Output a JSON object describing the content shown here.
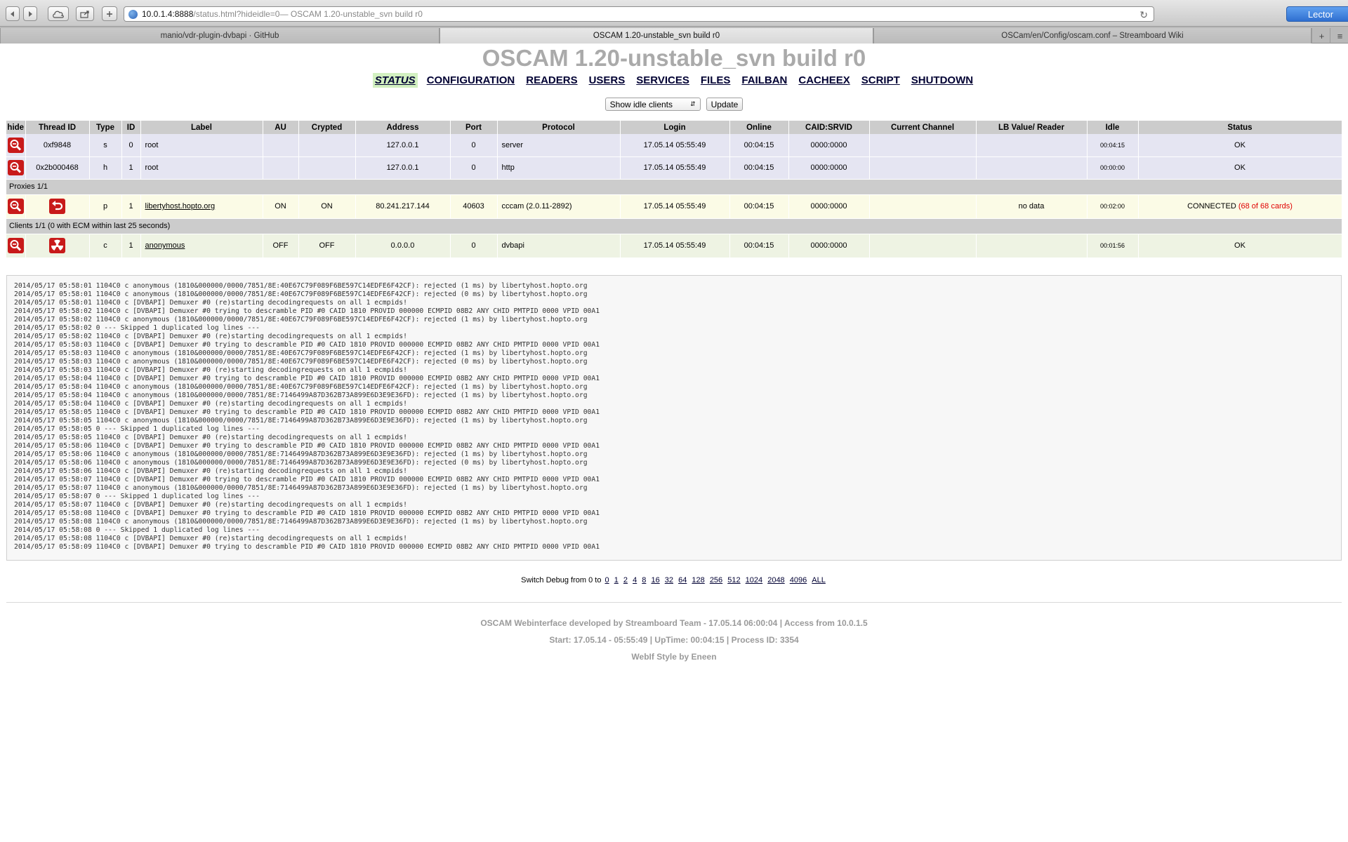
{
  "browser": {
    "url_host": "10.0.1.4:8888",
    "url_path": "/status.html?hideidle=0",
    "url_suffix": " — OSCAM 1.20-unstable_svn build r0",
    "reader_label": "Lector",
    "tabs": [
      {
        "label": "manio/vdr-plugin-dvbapi · GitHub"
      },
      {
        "label": "OSCAM 1.20-unstable_svn build r0"
      },
      {
        "label": "OSCam/en/Config/oscam.conf – Streamboard Wiki"
      }
    ]
  },
  "page": {
    "title": "OSCAM 1.20-unstable_svn build r0"
  },
  "nav": [
    "STATUS",
    "CONFIGURATION",
    "READERS",
    "USERS",
    "SERVICES",
    "FILES",
    "FAILBAN",
    "CACHEEX",
    "SCRIPT",
    "SHUTDOWN"
  ],
  "filter": {
    "select_value": "Show idle clients",
    "update_label": "Update"
  },
  "table": {
    "headers": [
      "hide",
      "Thread ID",
      "Type",
      "ID",
      "Label",
      "AU",
      "Crypted",
      "Address",
      "Port",
      "Protocol",
      "Login",
      "Online",
      "CAID:SRVID",
      "Current Channel",
      "LB Value/ Reader",
      "Idle",
      "Status"
    ],
    "server_rows": [
      {
        "thread": "0xf9848",
        "type": "s",
        "id": "0",
        "label": "root",
        "au": "",
        "crypted": "",
        "address": "127.0.0.1",
        "port": "0",
        "protocol": "server",
        "login": "17.05.14 05:55:49",
        "online": "00:04:15",
        "caid": "0000:0000",
        "channel": "",
        "lb": "",
        "idle": "00:04:15",
        "status": "OK"
      },
      {
        "thread": "0x2b000468",
        "type": "h",
        "id": "1",
        "label": "root",
        "au": "",
        "crypted": "",
        "address": "127.0.0.1",
        "port": "0",
        "protocol": "http",
        "login": "17.05.14 05:55:49",
        "online": "00:04:15",
        "caid": "0000:0000",
        "channel": "",
        "lb": "",
        "idle": "00:00:00",
        "status": "OK"
      }
    ],
    "proxies_caption": "Proxies 1/1",
    "proxy_row": {
      "type": "p",
      "id": "1",
      "label": "libertyhost.hopto.org",
      "au": "ON",
      "crypted": "ON",
      "address": "80.241.217.144",
      "port": "40603",
      "protocol": "cccam (2.0.11-2892)",
      "login": "17.05.14 05:55:49",
      "online": "00:04:15",
      "caid": "0000:0000",
      "channel": "",
      "lb": "no data",
      "idle": "00:02:00",
      "status": "CONNECTED",
      "cards": "(68 of 68 cards)"
    },
    "clients_caption": "Clients 1/1 (0 with ECM within last 25 seconds)",
    "client_row": {
      "type": "c",
      "id": "1",
      "label": "anonymous",
      "au": "OFF",
      "crypted": "OFF",
      "address": "0.0.0.0",
      "port": "0",
      "protocol": "dvbapi",
      "login": "17.05.14 05:55:49",
      "online": "00:04:15",
      "caid": "0000:0000",
      "channel": "",
      "lb": "",
      "idle": "00:01:56",
      "status": "OK"
    }
  },
  "log_lines": [
    "2014/05/17 05:58:01 1104C0 c anonymous (1810&000000/0000/7851/8E:40E67C79F089F6BE597C14EDFE6F42CF): rejected (1 ms) by libertyhost.hopto.org",
    "2014/05/17 05:58:01 1104C0 c anonymous (1810&000000/0000/7851/8E:40E67C79F089F6BE597C14EDFE6F42CF): rejected (0 ms) by libertyhost.hopto.org",
    "2014/05/17 05:58:01 1104C0 c [DVBAPI] Demuxer #0 (re)starting decodingrequests on all 1 ecmpids!",
    "2014/05/17 05:58:02 1104C0 c [DVBAPI] Demuxer #0 trying to descramble PID #0 CAID 1810 PROVID 000000 ECMPID 08B2 ANY CHID PMTPID 0000 VPID 00A1",
    "2014/05/17 05:58:02 1104C0 c anonymous (1810&000000/0000/7851/8E:40E67C79F089F6BE597C14EDFE6F42CF): rejected (1 ms) by libertyhost.hopto.org",
    "2014/05/17 05:58:02 0 --- Skipped 1 duplicated log lines ---",
    "2014/05/17 05:58:02 1104C0 c [DVBAPI] Demuxer #0 (re)starting decodingrequests on all 1 ecmpids!",
    "2014/05/17 05:58:03 1104C0 c [DVBAPI] Demuxer #0 trying to descramble PID #0 CAID 1810 PROVID 000000 ECMPID 08B2 ANY CHID PMTPID 0000 VPID 00A1",
    "2014/05/17 05:58:03 1104C0 c anonymous (1810&000000/0000/7851/8E:40E67C79F089F6BE597C14EDFE6F42CF): rejected (1 ms) by libertyhost.hopto.org",
    "2014/05/17 05:58:03 1104C0 c anonymous (1810&000000/0000/7851/8E:40E67C79F089F6BE597C14EDFE6F42CF): rejected (0 ms) by libertyhost.hopto.org",
    "2014/05/17 05:58:03 1104C0 c [DVBAPI] Demuxer #0 (re)starting decodingrequests on all 1 ecmpids!",
    "2014/05/17 05:58:04 1104C0 c [DVBAPI] Demuxer #0 trying to descramble PID #0 CAID 1810 PROVID 000000 ECMPID 08B2 ANY CHID PMTPID 0000 VPID 00A1",
    "2014/05/17 05:58:04 1104C0 c anonymous (1810&000000/0000/7851/8E:40E67C79F089F6BE597C14EDFE6F42CF): rejected (1 ms) by libertyhost.hopto.org",
    "2014/05/17 05:58:04 1104C0 c anonymous (1810&000000/0000/7851/8E:7146499A87D362B73A899E6D3E9E36FD): rejected (1 ms) by libertyhost.hopto.org",
    "2014/05/17 05:58:04 1104C0 c [DVBAPI] Demuxer #0 (re)starting decodingrequests on all 1 ecmpids!",
    "2014/05/17 05:58:05 1104C0 c [DVBAPI] Demuxer #0 trying to descramble PID #0 CAID 1810 PROVID 000000 ECMPID 08B2 ANY CHID PMTPID 0000 VPID 00A1",
    "2014/05/17 05:58:05 1104C0 c anonymous (1810&000000/0000/7851/8E:7146499A87D362B73A899E6D3E9E36FD): rejected (1 ms) by libertyhost.hopto.org",
    "2014/05/17 05:58:05 0 --- Skipped 1 duplicated log lines ---",
    "2014/05/17 05:58:05 1104C0 c [DVBAPI] Demuxer #0 (re)starting decodingrequests on all 1 ecmpids!",
    "2014/05/17 05:58:06 1104C0 c [DVBAPI] Demuxer #0 trying to descramble PID #0 CAID 1810 PROVID 000000 ECMPID 08B2 ANY CHID PMTPID 0000 VPID 00A1",
    "2014/05/17 05:58:06 1104C0 c anonymous (1810&000000/0000/7851/8E:7146499A87D362B73A899E6D3E9E36FD): rejected (1 ms) by libertyhost.hopto.org",
    "2014/05/17 05:58:06 1104C0 c anonymous (1810&000000/0000/7851/8E:7146499A87D362B73A899E6D3E9E36FD): rejected (0 ms) by libertyhost.hopto.org",
    "2014/05/17 05:58:06 1104C0 c [DVBAPI] Demuxer #0 (re)starting decodingrequests on all 1 ecmpids!",
    "2014/05/17 05:58:07 1104C0 c [DVBAPI] Demuxer #0 trying to descramble PID #0 CAID 1810 PROVID 000000 ECMPID 08B2 ANY CHID PMTPID 0000 VPID 00A1",
    "2014/05/17 05:58:07 1104C0 c anonymous (1810&000000/0000/7851/8E:7146499A87D362B73A899E6D3E9E36FD): rejected (1 ms) by libertyhost.hopto.org",
    "2014/05/17 05:58:07 0 --- Skipped 1 duplicated log lines ---",
    "2014/05/17 05:58:07 1104C0 c [DVBAPI] Demuxer #0 (re)starting decodingrequests on all 1 ecmpids!",
    "2014/05/17 05:58:08 1104C0 c [DVBAPI] Demuxer #0 trying to descramble PID #0 CAID 1810 PROVID 000000 ECMPID 08B2 ANY CHID PMTPID 0000 VPID 00A1",
    "2014/05/17 05:58:08 1104C0 c anonymous (1810&000000/0000/7851/8E:7146499A87D362B73A899E6D3E9E36FD): rejected (1 ms) by libertyhost.hopto.org",
    "2014/05/17 05:58:08 0 --- Skipped 1 duplicated log lines ---",
    "2014/05/17 05:58:08 1104C0 c [DVBAPI] Demuxer #0 (re)starting decodingrequests on all 1 ecmpids!",
    "2014/05/17 05:58:09 1104C0 c [DVBAPI] Demuxer #0 trying to descramble PID #0 CAID 1810 PROVID 000000 ECMPID 08B2 ANY CHID PMTPID 0000 VPID 00A1"
  ],
  "debug": {
    "label": "Switch Debug from 0 to",
    "levels": [
      "0",
      "1",
      "2",
      "4",
      "8",
      "16",
      "32",
      "64",
      "128",
      "256",
      "512",
      "1024",
      "2048",
      "4096",
      "ALL"
    ]
  },
  "footer": {
    "line1": "OSCAM Webinterface developed by Streamboard Team - 17.05.14 06:00:04 | Access from 10.0.1.5",
    "line2": "Start: 17.05.14 - 05:55:49 | UpTime: 00:04:15 | Process ID: 3354",
    "line3": "WebIf Style by Eneen"
  },
  "colors": {
    "title": "#aaaaaa",
    "nav": "#000033",
    "nav_active_bg": "#d2f0c0",
    "icon_red": "#c81a1a",
    "cards_red": "#e00000"
  },
  "icons": [
    "back-icon",
    "forward-icon",
    "cloud-icon",
    "share-icon",
    "add-tab-icon",
    "reload-icon",
    "hide-magnifier-icon",
    "restart-icon",
    "radiation-icon"
  ]
}
